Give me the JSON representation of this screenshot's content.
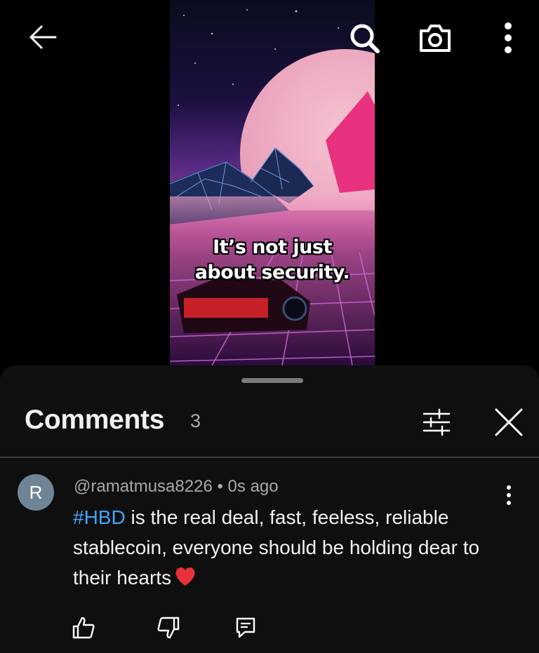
{
  "video": {
    "caption_line1": "It’s not just",
    "caption_line2": "about security."
  },
  "toolbar": {
    "icons": [
      "back-arrow-icon",
      "search-icon",
      "camera-icon",
      "more-vertical-icon"
    ]
  },
  "comments_panel": {
    "title": "Comments",
    "count": "3",
    "icons": [
      "filter-icon",
      "close-icon"
    ]
  },
  "comment": {
    "avatar_letter": "R",
    "avatar_color": "#6f8596",
    "author": "@ramatmusa8226",
    "separator": " • ",
    "time": "0s ago",
    "hashtag": "#HBD",
    "text": " is the real deal, fast, feeless, reliable stablecoin, everyone should be holding dear to their hearts",
    "emoji": "red-heart-icon",
    "actions": [
      "like-icon",
      "dislike-icon",
      "reply-icon"
    ]
  },
  "colors": {
    "background": "#000000",
    "sheet": "#0f0f0f",
    "hashtag": "#3ea6ff",
    "secondary_text": "#aaaaaa"
  }
}
